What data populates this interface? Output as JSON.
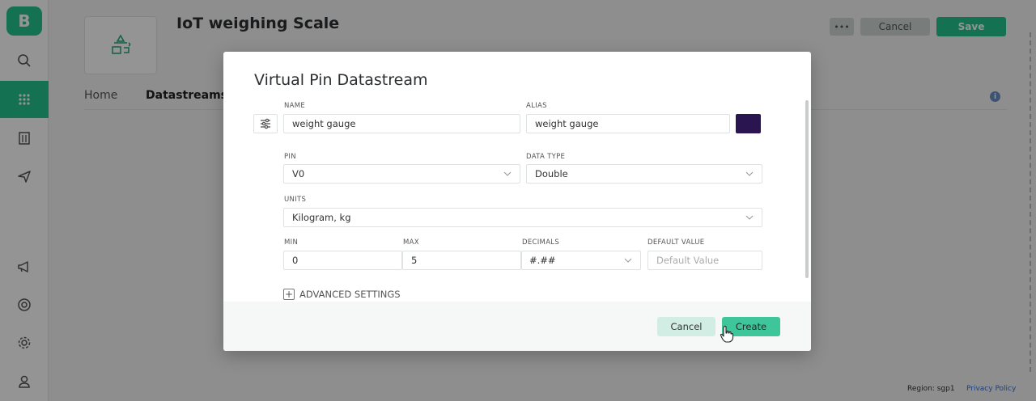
{
  "app": {
    "logo_letter": "B",
    "title": "IoT weighing Scale",
    "more_label": "•••",
    "cancel_label": "Cancel",
    "save_label": "Save",
    "tabs": [
      "Home",
      "Datastreams"
    ],
    "active_tab": "Datastreams",
    "info_glyph": "i",
    "footer": {
      "region": "Region: sgp1",
      "privacy": "Privacy Policy"
    },
    "sidebar_icons": [
      "search-icon",
      "apps-grid-icon",
      "building-icon",
      "send-icon",
      "megaphone-icon",
      "help-circle-icon",
      "gear-icon",
      "user-icon"
    ],
    "accent_color": "#23c48e"
  },
  "modal": {
    "title": "Virtual Pin Datastream",
    "name": {
      "label": "NAME",
      "value": "weight gauge"
    },
    "alias": {
      "label": "ALIAS",
      "value": "weight gauge"
    },
    "color": "#2b1550",
    "pin": {
      "label": "PIN",
      "value": "V0"
    },
    "data_type": {
      "label": "DATA TYPE",
      "value": "Double"
    },
    "units": {
      "label": "UNITS",
      "value": "Kilogram, kg"
    },
    "min": {
      "label": "MIN",
      "value": "0"
    },
    "max": {
      "label": "MAX",
      "value": "5"
    },
    "decimals": {
      "label": "DECIMALS",
      "value": "#.##"
    },
    "default_value": {
      "label": "DEFAULT VALUE",
      "placeholder": "Default Value"
    },
    "advanced_label": "ADVANCED SETTINGS",
    "cancel_label": "Cancel",
    "create_label": "Create"
  }
}
